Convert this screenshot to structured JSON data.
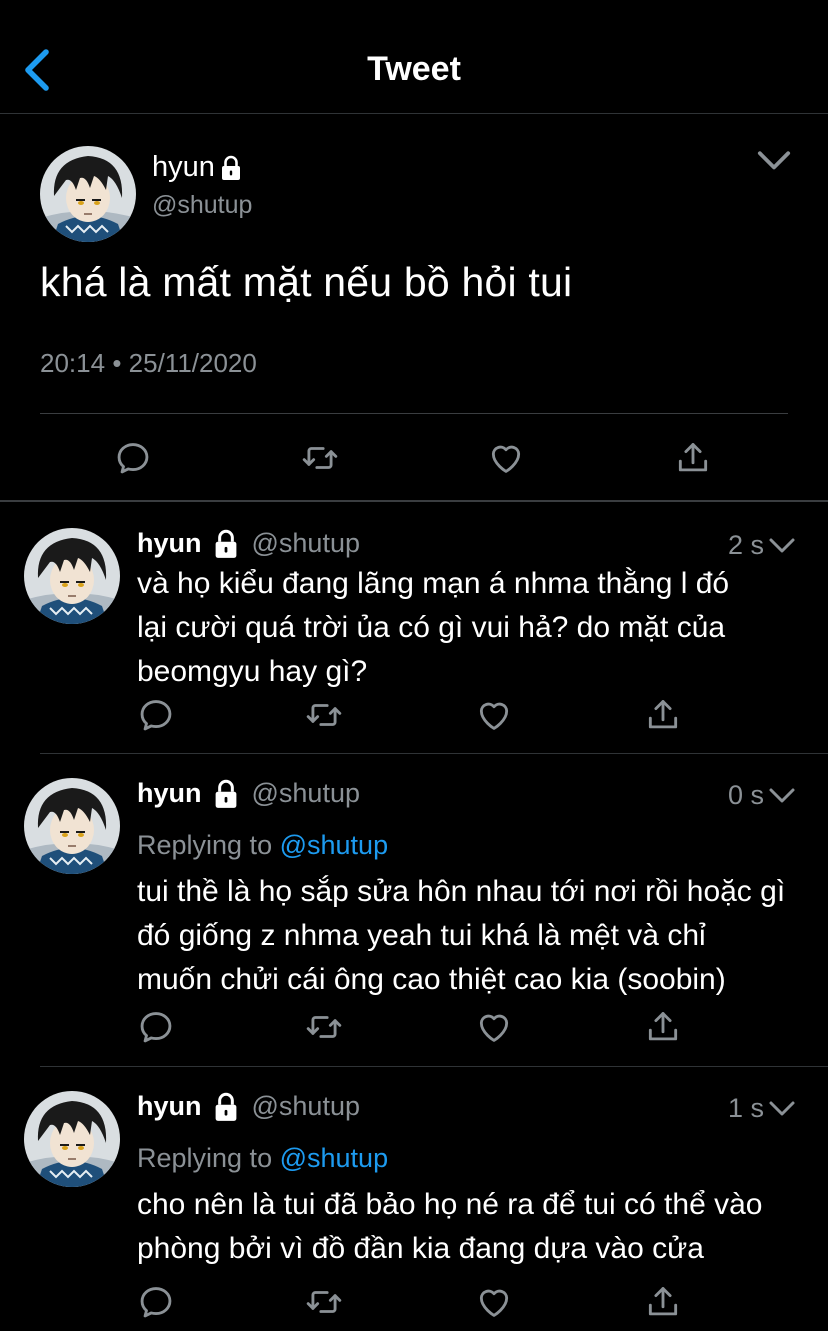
{
  "header": {
    "title": "Tweet",
    "back_icon": "chevron-left-icon",
    "accent": "#1d9bf0"
  },
  "main_tweet": {
    "name": "hyun",
    "handle": "@shutup",
    "text": "khá là mất mặt nếu bồ hỏi tui",
    "time": "20:14",
    "separator": "•",
    "date": "25/11/2020"
  },
  "replies": [
    {
      "name": "hyun",
      "handle": "@shutup",
      "time": "2 s",
      "replying_prefix": "",
      "replying_mention": "",
      "lines": [
        "và họ kiểu đang lãng mạn á nhma thằng l đó",
        "lại cười quá trời ủa có gì vui hả? do mặt của",
        "beomgyu hay gì?"
      ]
    },
    {
      "name": "hyun",
      "handle": "@shutup",
      "time": "0 s",
      "replying_prefix": "Replying to",
      "replying_mention": "@shutup",
      "lines": [
        "tui thề là họ sắp sửa hôn nhau tới nơi rồi hoặc gì",
        "đó giống z nhma yeah tui khá là mệt và chỉ",
        "muốn chửi cái ông cao thiệt cao kia (soobin)"
      ]
    },
    {
      "name": "hyun",
      "handle": "@shutup",
      "time": "1 s",
      "replying_prefix": "Replying to",
      "replying_mention": "@shutup",
      "lines": [
        "cho nên là tui đã bảo họ né ra để tui có thể vào",
        "phòng bởi vì đồ đần kia đang dựa vào cửa"
      ]
    }
  ],
  "icons": [
    "reply-icon",
    "retweet-icon",
    "like-icon",
    "share-icon",
    "lock-icon",
    "chevron-down-icon"
  ]
}
